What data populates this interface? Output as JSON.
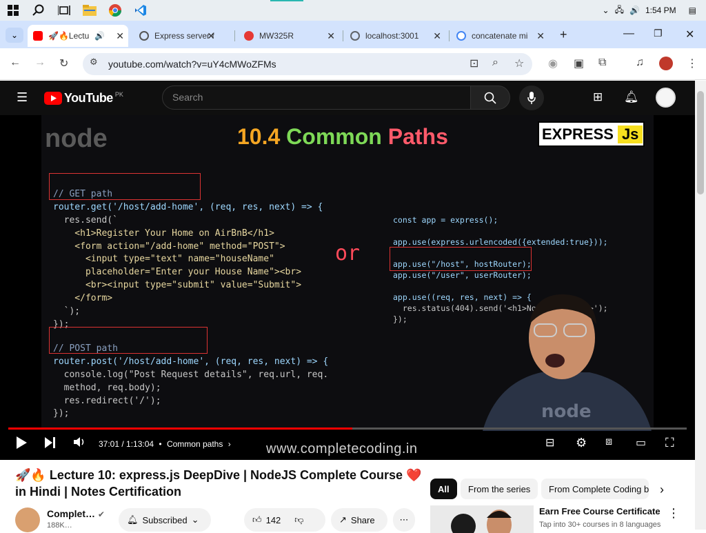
{
  "taskbar": {
    "clock": "1:54 PM"
  },
  "tabs": [
    {
      "label": "Lectu",
      "emoji": "🚀🔥",
      "color": "#ff0000"
    },
    {
      "label": "Express server f",
      "color": "#555555"
    },
    {
      "label": "MW325R",
      "color": "#e53935"
    },
    {
      "label": "localhost:3001",
      "color": "#5f6368"
    },
    {
      "label": "concatenate mi",
      "color": "#4285f4"
    }
  ],
  "browser": {
    "url": "youtube.com/watch?v=uY4cMWoZFMs",
    "new_tab": "+"
  },
  "youtube": {
    "logo": "YouTube",
    "region": "PK",
    "search_placeholder": "Search"
  },
  "slide": {
    "title_number": "10.4",
    "title_word1": "Common",
    "title_word2": "Paths",
    "express_badge": "EXPRESS",
    "express_js": "Js",
    "node_logo": "node",
    "or_text": "or"
  },
  "code_left": {
    "get_comment": "// GET path",
    "get_line1": "router.get('/host/add-home', (req, res, next) => {",
    "get_line2": "  res.send(`",
    "get_line3": "    <h1>Register Your Home on AirBnB</h1>",
    "get_line4": "    <form action=\"/add-home\" method=\"POST\">",
    "get_line5": "      <input type=\"text\" name=\"houseName\"",
    "get_line6": "      placeholder=\"Enter your House Name\"><br>",
    "get_line7": "      <br><input type=\"submit\" value=\"Submit\">",
    "get_line8": "    </form>",
    "get_line9": "  `);",
    "get_line10": "});",
    "post_comment": "// POST path",
    "post_line1": "router.post('/host/add-home', (req, res, next) => {",
    "post_line2": "  console.log(\"Post Request details\", req.url, req.",
    "post_line3": "  method, req.body);",
    "post_line4": "  res.redirect('/');",
    "post_line5": "});"
  },
  "code_right": {
    "line1": "const app = express();",
    "line2": "app.use(express.urlencoded({extended:true}));",
    "line3": "app.use(\"/host\", hostRouter);",
    "line4": "app.use(\"/user\", userRouter);",
    "line5": "app.use((req, res, next) => {",
    "line6": "  res.status(404).send('<h1>Not Found</h1>');",
    "line7": "});"
  },
  "player": {
    "time": "37:01 / 1:13:04",
    "chapter": "Common paths",
    "progress_fraction": 0.507,
    "watermark": "www.completecoding.in"
  },
  "video": {
    "title_emoji": "🚀🔥",
    "title": "Lecture 10: express.js DeepDive | NodeJS Complete Course",
    "title_heart": "❤️",
    "title_rest": "in Hindi | Notes Certification",
    "channel": "Complet…",
    "subscribers": "188K…",
    "subscribed_label": "Subscribed",
    "likes": "142",
    "share_label": "Share"
  },
  "chips": [
    "All",
    "From the series",
    "From Complete Coding by"
  ],
  "recommendation": {
    "title": "Earn Free Course Certificate",
    "subtitle": "Tap into 30+ courses in 8 languages"
  }
}
